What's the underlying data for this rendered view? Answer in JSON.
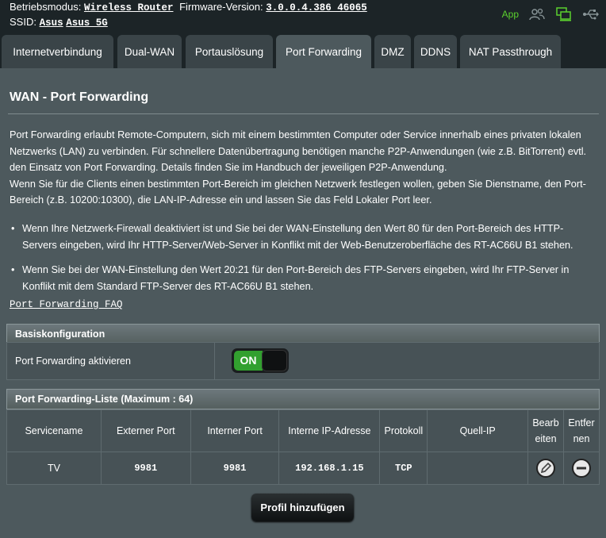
{
  "header": {
    "mode_label": "Betriebsmodus:",
    "mode_value": "Wireless Router",
    "firmware_label": "Firmware-Version:",
    "firmware_value": "3.0.0.4.386_46065",
    "ssid_label": "SSID:",
    "ssid_1": "Asus",
    "ssid_2": "Asus_5G",
    "app_label": "App",
    "icons": [
      "users-icon",
      "network-status-icon",
      "usb-icon"
    ]
  },
  "tabs": [
    {
      "label": "Internetverbindung"
    },
    {
      "label": "Dual-WAN"
    },
    {
      "label": "Portauslösung"
    },
    {
      "label": "Port Forwarding",
      "active": true
    },
    {
      "label": "DMZ"
    },
    {
      "label": "DDNS"
    },
    {
      "label": "NAT Passthrough"
    }
  ],
  "page": {
    "title": "WAN - Port Forwarding",
    "description_1": "Port Forwarding erlaubt Remote-Computern, sich mit einem bestimmten Computer oder Service innerhalb eines privaten lokalen Netzwerks (LAN) zu verbinden. Für schnellere Datenübertragung benötigen manche P2P-Anwendungen (wie z.B. BitTorrent) evtl. den Einsatz von Port Forwarding. Details finden Sie im Handbuch der jeweiligen P2P-Anwendung.",
    "description_2": "Wenn Sie für die Clients einen bestimmten Port-Bereich im gleichen Netzwerk festlegen wollen, geben Sie Dienstname, den Port-Bereich (z.B. 10200:10300), die LAN-IP-Adresse ein und lassen Sie das Feld Lokaler Port leer.",
    "bullet_1": "Wenn Ihre Netzwerk-Firewall deaktiviert ist und Sie bei der WAN-Einstellung den Wert 80 für den Port-Bereich des HTTP-Servers eingeben, wird Ihr HTTP-Server/Web-Server in Konflikt mit der Web-Benutzeroberfläche des RT-AC66U B1 stehen.",
    "bullet_2": "Wenn Sie bei der WAN-Einstellung den Wert 20:21 für den Port-Bereich des FTP-Servers eingeben, wird Ihr FTP-Server in Konflikt mit dem Standard FTP-Server des RT-AC66U B1 stehen.",
    "faq_link": "Port Forwarding FAQ"
  },
  "basic_config": {
    "heading": "Basiskonfiguration",
    "enable_label": "Port Forwarding aktivieren",
    "toggle_state": "ON"
  },
  "list": {
    "heading": "Port Forwarding-Liste (Maximum : 64)",
    "columns": [
      "Servicename",
      "Externer Port",
      "Interner Port",
      "Interne IP-Adresse",
      "Protokoll",
      "Quell-IP",
      "Bearb eiten",
      "Entfer nen"
    ],
    "rows": [
      {
        "service": "TV",
        "ext_port": "9981",
        "int_port": "9981",
        "ip": "192.168.1.15",
        "protocol": "TCP",
        "source_ip": ""
      }
    ]
  },
  "add_button": "Profil hinzufügen",
  "colors": {
    "accent_green": "#32a02f",
    "app_green": "#5bd12e",
    "panel": "#4d595d",
    "background": "#1c2427"
  }
}
